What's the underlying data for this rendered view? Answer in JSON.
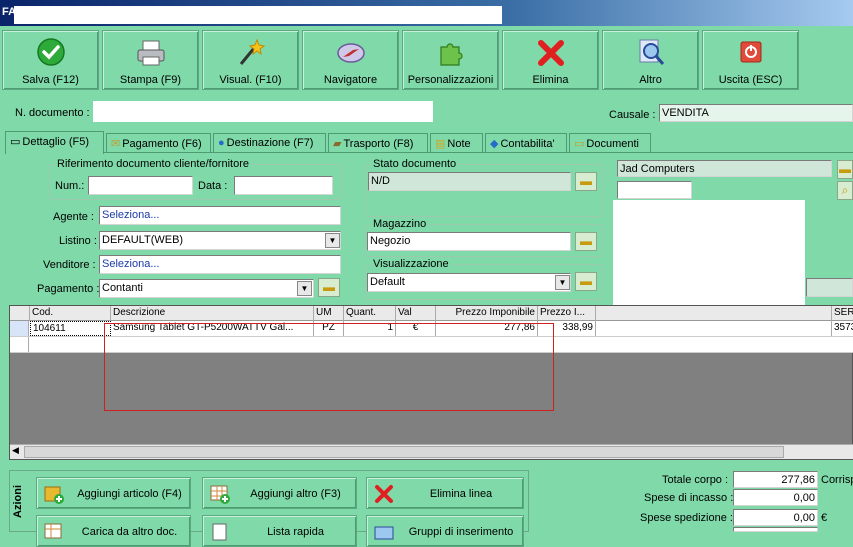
{
  "window": {
    "title": "FA"
  },
  "toolbar": {
    "buttons": [
      {
        "label": "Salva (F12)",
        "icon": "check-icon"
      },
      {
        "label": "Stampa (F9)",
        "icon": "printer-icon"
      },
      {
        "label": "Visual. (F10)",
        "icon": "magic-wand-icon"
      },
      {
        "label": "Navigatore",
        "icon": "compass-icon"
      },
      {
        "label": "Personalizzazioni",
        "icon": "puzzle-icon"
      },
      {
        "label": "Elimina",
        "icon": "delete-x-icon"
      },
      {
        "label": "Altro",
        "icon": "magnifier-icon"
      },
      {
        "label": "Uscita (ESC)",
        "icon": "exit-icon"
      }
    ]
  },
  "header": {
    "doc_label": "N. documento :",
    "doc_value": "",
    "causale_label": "Causale :",
    "causale_value": "VENDITA"
  },
  "tabs": [
    {
      "label": "Dettaglio (F5)"
    },
    {
      "label": "Pagamento (F6)"
    },
    {
      "label": "Destinazione (F7)"
    },
    {
      "label": "Trasporto (F8)"
    },
    {
      "label": "Note"
    },
    {
      "label": "Contabilita'"
    },
    {
      "label": "Documenti"
    }
  ],
  "detail": {
    "rif_title": "Riferimento documento cliente/fornitore",
    "num_label": "Num.:",
    "num_value": "",
    "data_label": "Data :",
    "data_value": "",
    "agente_label": "Agente :",
    "agente_value": "Seleziona...",
    "listino_label": "Listino :",
    "listino_value": "DEFAULT(WEB)",
    "venditore_label": "Venditore :",
    "venditore_value": "Seleziona...",
    "pagamento_label": "Pagamento :",
    "pagamento_value": "Contanti",
    "stato_title": "Stato documento",
    "stato_value": "N/D",
    "magazzino_title": "Magazzino",
    "magazzino_value": "Negozio",
    "visual_title": "Visualizzazione",
    "visual_value": "Default",
    "cliente_value": "Jad Computers"
  },
  "grid": {
    "columns": [
      "Cod.",
      "Descrizione",
      "UM",
      "Quant.",
      "Val",
      "Prezzo Imponibile",
      "Prezzo I...",
      "SER"
    ],
    "rows": [
      {
        "cod": "104611",
        "descr": "Samsung Tablet GT-P5200WATTV Gal...",
        "um": "PZ",
        "qty": "1",
        "val": "€",
        "prezzo_imp": "277,86",
        "prezzo_i": "338,99",
        "ser": "3573"
      }
    ]
  },
  "actions": {
    "title": "Azioni",
    "buttons": [
      {
        "label": "Aggiungi articolo (F4)",
        "icon": "add-article-icon"
      },
      {
        "label": "Aggiungi altro (F3)",
        "icon": "add-other-icon"
      },
      {
        "label": "Elimina linea",
        "icon": "delete-line-icon"
      },
      {
        "label": "Carica da altro doc.",
        "icon": "load-doc-icon"
      },
      {
        "label": "Lista rapida",
        "icon": "quick-list-icon"
      },
      {
        "label": "Gruppi di inserimento",
        "icon": "groups-icon"
      }
    ]
  },
  "totals": {
    "totale_corpo_label": "Totale corpo :",
    "totale_corpo_value": "277,86",
    "corrisp_label": "Corrisp",
    "spese_incasso_label": "Spese di incasso :",
    "spese_incasso_value": "0,00",
    "spese_spedizione_label": "Spese spedizione :",
    "spese_spedizione_value": "0,00",
    "currency": "€"
  }
}
